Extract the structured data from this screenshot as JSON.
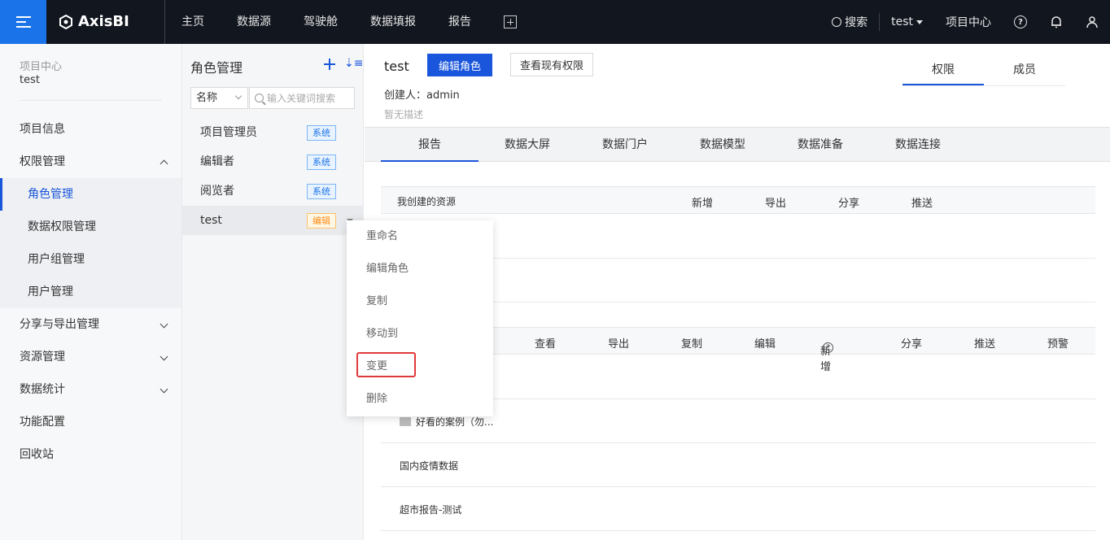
{
  "topbar": {
    "logo": "AxisBI",
    "nav": [
      "主页",
      "数据源",
      "驾驶舱",
      "数据填报",
      "报告"
    ],
    "search_label": "搜索",
    "user": "test",
    "project_center": "项目中心"
  },
  "sidebar": {
    "project_label": "项目中心",
    "project_name": "test",
    "items": [
      {
        "label": "项目信息"
      },
      {
        "label": "权限管理"
      },
      {
        "label": "角色管理"
      },
      {
        "label": "数据权限管理"
      },
      {
        "label": "用户组管理"
      },
      {
        "label": "用户管理"
      },
      {
        "label": "分享与导出管理"
      },
      {
        "label": "资源管理"
      },
      {
        "label": "数据统计"
      },
      {
        "label": "功能配置"
      },
      {
        "label": "回收站"
      }
    ]
  },
  "roles": {
    "title": "角色管理",
    "filter_value": "名称",
    "search_placeholder": "输入关键词搜索",
    "list": [
      {
        "name": "项目管理员",
        "tag": "系统"
      },
      {
        "name": "编辑者",
        "tag": "系统"
      },
      {
        "name": "阅览者",
        "tag": "系统"
      },
      {
        "name": "test",
        "tag": "编辑"
      }
    ]
  },
  "context_menu": {
    "items": [
      "重命名",
      "编辑角色",
      "复制",
      "移动到",
      "变更",
      "删除"
    ],
    "highlighted": "变更"
  },
  "main": {
    "role_name": "test",
    "edit_button": "编辑角色",
    "view_button": "查看现有权限",
    "creator": "创建人：admin",
    "description": "暂无描述",
    "right_tabs": [
      "权限",
      "成员"
    ],
    "resource_tabs": [
      "报告",
      "数据大屏",
      "数据门户",
      "数据模型",
      "数据准备",
      "数据连接"
    ],
    "table1": {
      "headers": [
        "我创建的资源",
        "新增",
        "导出",
        "分享",
        "推送"
      ]
    },
    "table2": {
      "headers": [
        "查看",
        "导出",
        "复制",
        "编辑",
        "新增",
        "分享",
        "推送",
        "预警"
      ],
      "rows": [
        "好看的案例（勿...",
        "国内疫情数据",
        "超市报告-测试"
      ]
    }
  }
}
